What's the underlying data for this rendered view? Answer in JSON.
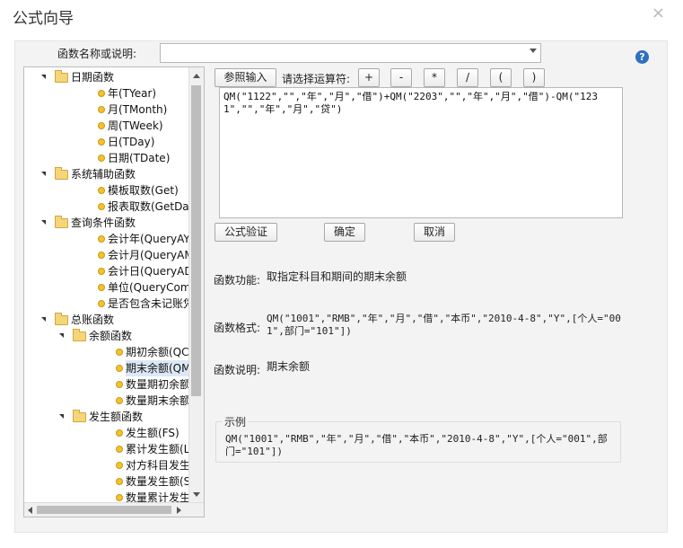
{
  "window": {
    "title": "公式向导",
    "close_glyph": "×"
  },
  "function_name": {
    "label": "函数名称或说明:",
    "value": ""
  },
  "help_glyph": "?",
  "tree": [
    {
      "label": "日期函数",
      "kind": "folder",
      "level": 0
    },
    {
      "label": "年(TYear)",
      "kind": "leaf",
      "level": 1
    },
    {
      "label": "月(TMonth)",
      "kind": "leaf",
      "level": 1
    },
    {
      "label": "周(TWeek)",
      "kind": "leaf",
      "level": 1
    },
    {
      "label": "日(TDay)",
      "kind": "leaf",
      "level": 1
    },
    {
      "label": "日期(TDate)",
      "kind": "leaf",
      "level": 1
    },
    {
      "label": "系统辅助函数",
      "kind": "folder",
      "level": 0
    },
    {
      "label": "模板取数(Get)",
      "kind": "leaf",
      "level": 1
    },
    {
      "label": "报表取数(GetData)",
      "kind": "leaf",
      "level": 1
    },
    {
      "label": "查询条件函数",
      "kind": "folder",
      "level": 0
    },
    {
      "label": "会计年(QueryAYear)",
      "kind": "leaf",
      "level": 1
    },
    {
      "label": "会计月(QueryAMonth)",
      "kind": "leaf",
      "level": 1
    },
    {
      "label": "会计日(QueryADay)",
      "kind": "leaf",
      "level": 1
    },
    {
      "label": "单位(QueryCom)",
      "kind": "leaf",
      "level": 1
    },
    {
      "label": "是否包含未记账凭证",
      "kind": "leaf",
      "level": 1
    },
    {
      "label": "总账函数",
      "kind": "folder",
      "level": 0
    },
    {
      "label": "余额函数",
      "kind": "folder",
      "level": 1
    },
    {
      "label": "期初余额(QC)",
      "kind": "leaf",
      "level": 2
    },
    {
      "label": "期末余额(QM)",
      "kind": "leaf",
      "level": 2,
      "selected": true
    },
    {
      "label": "数量期初余额(SQC)",
      "kind": "leaf",
      "level": 2
    },
    {
      "label": "数量期末余额(SQM)",
      "kind": "leaf",
      "level": 2
    },
    {
      "label": "发生额函数",
      "kind": "folder",
      "level": 1
    },
    {
      "label": "发生额(FS)",
      "kind": "leaf",
      "level": 2
    },
    {
      "label": "累计发生额(LFS)",
      "kind": "leaf",
      "level": 2
    },
    {
      "label": "对方科目发生额",
      "kind": "leaf",
      "level": 2
    },
    {
      "label": "数量发生额(SFS)",
      "kind": "leaf",
      "level": 2
    },
    {
      "label": "数量累计发生额",
      "kind": "leaf",
      "level": 2
    }
  ],
  "toolbar": {
    "ref_input_label": "参照输入",
    "operator_prompt": "请选择运算符:",
    "operators": [
      "+",
      "-",
      "*",
      "/",
      "(",
      ")"
    ]
  },
  "formula": "QM(\"1122\",\"\",\"年\",\"月\",\"借\")+QM(\"2203\",\"\",\"年\",\"月\",\"借\")-QM(\"1231\",\"\",\"年\",\"月\",\"贷\")",
  "actions": {
    "validate_label": "公式验证",
    "ok_label": "确定",
    "cancel_label": "取消"
  },
  "info": {
    "function_label": "函数功能:",
    "function_value": "取指定科目和期间的期末余额",
    "format_label": "函数格式:",
    "format_value": "QM(\"1001\",\"RMB\",\"年\",\"月\",\"借\",\"本币\",\"2010-4-8\",\"Y\",[个人=\"001\",部门=\"101\"])",
    "desc_label": "函数说明:",
    "desc_value": "期末余额"
  },
  "example": {
    "legend": "示例",
    "text": "QM(\"1001\",\"RMB\",\"年\",\"月\",\"借\",\"本币\",\"2010-4-8\",\"Y\",[个人=\"001\",部门=\"101\"])"
  }
}
